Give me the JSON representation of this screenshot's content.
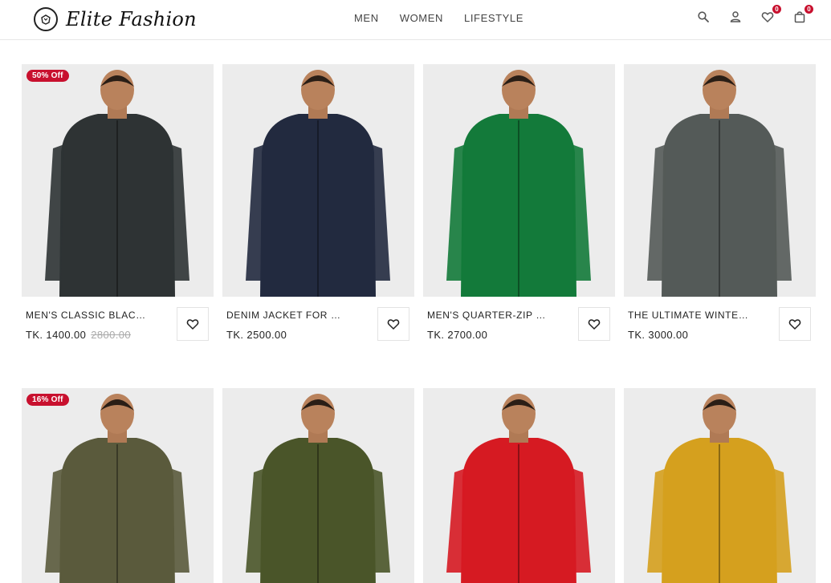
{
  "brand": {
    "name": "Elite Fashion",
    "logo_icon": "brand-emblem-icon"
  },
  "nav": {
    "items": [
      "MEN",
      "WOMEN",
      "LIFESTYLE"
    ]
  },
  "header_icons": {
    "search": "search-icon",
    "account": "user-icon",
    "wishlist": {
      "icon": "heart-icon",
      "count": "0"
    },
    "cart": {
      "icon": "bag-icon",
      "count": "0"
    }
  },
  "colors": {
    "accent": "#c8102e"
  },
  "products": [
    {
      "title": "MEN'S CLASSIC BLACK...",
      "price": "TK. 1400.00",
      "old_price": "2800.00",
      "discount": "50% Off",
      "jacket_color": "#2e3334"
    },
    {
      "title": "DENIM JACKET FOR MEN",
      "price": "TK. 2500.00",
      "old_price": "",
      "discount": "",
      "jacket_color": "#222a3f"
    },
    {
      "title": "MEN'S QUARTER-ZIP POLAR...",
      "price": "TK. 2700.00",
      "old_price": "",
      "discount": "",
      "jacket_color": "#137a3a"
    },
    {
      "title": "THE ULTIMATE WINTER...",
      "price": "TK. 3000.00",
      "old_price": "",
      "discount": "",
      "jacket_color": "#545a58"
    },
    {
      "title": "",
      "price": "",
      "old_price": "",
      "discount": "16% Off",
      "jacket_color": "#5a5a3c"
    },
    {
      "title": "",
      "price": "",
      "old_price": "",
      "discount": "",
      "jacket_color": "#4a5529"
    },
    {
      "title": "",
      "price": "",
      "old_price": "",
      "discount": "",
      "jacket_color": "#d61a22"
    },
    {
      "title": "",
      "price": "",
      "old_price": "",
      "discount": "",
      "jacket_color": "#d5a01e"
    }
  ]
}
